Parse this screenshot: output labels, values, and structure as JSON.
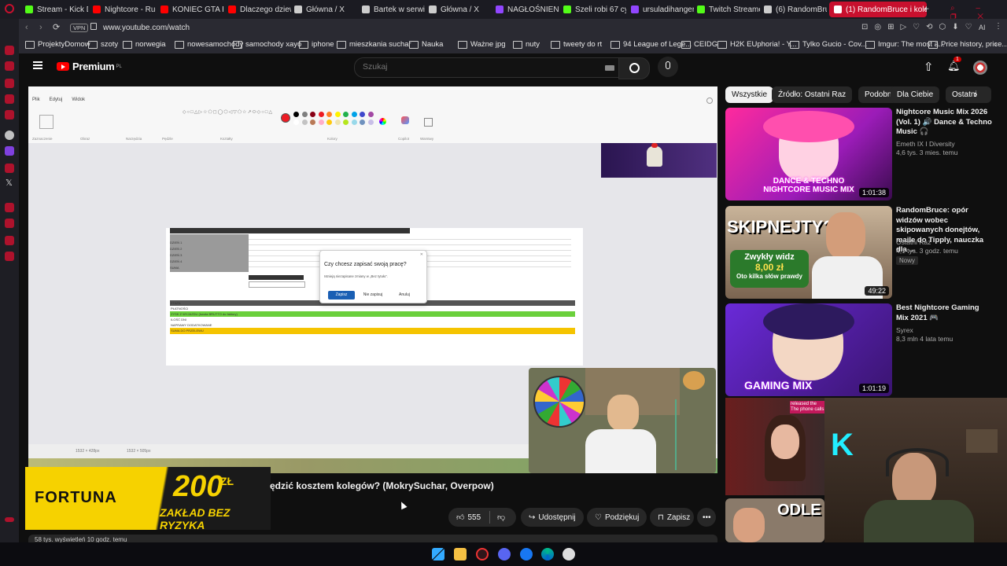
{
  "browser": {
    "tabs": [
      {
        "label": "Stream - Kick Da",
        "color": "#53fc18"
      },
      {
        "label": "Nightcore - Rude",
        "color": "#ff0000"
      },
      {
        "label": "KONIEC GTA RP",
        "color": "#ff0000"
      },
      {
        "label": "Dlaczego dziewc",
        "color": "#ff0000"
      },
      {
        "label": "Główna / X",
        "color": "#cccccc"
      },
      {
        "label": "Bartek w serwis",
        "color": "#cccccc"
      },
      {
        "label": "Główna / X",
        "color": "#cccccc"
      },
      {
        "label": "NAGŁOŚNIENIE",
        "color": "#9146ff"
      },
      {
        "label": "Szeli robi 67 cyc",
        "color": "#53fc18"
      },
      {
        "label": "ursuladihanger",
        "color": "#9146ff"
      },
      {
        "label": "Twitch Streamers",
        "color": "#53fc18"
      },
      {
        "label": "(6) RandomBruc",
        "color": "#cccccc"
      },
      {
        "label": "(1) RandomBruce i kole",
        "color": "#ffffff"
      }
    ],
    "url_badge": "VPN",
    "url": "www.youtube.com/watch",
    "ai_label": "AI",
    "bookmarks": [
      "ProjektyDomow",
      "szoty",
      "norwegia",
      "nowesamochody",
      "samochody xayo",
      "iphone",
      "mieszkania suchar",
      "Nauka",
      "Ważne jpg",
      "nuty",
      "tweety do rt",
      "94 League of Lege...",
      "CEIDG",
      "H2K EUphoria! - Y...",
      "Tylko Gucio - Cov...",
      "Imgur: The most a...",
      "Price history, price..."
    ]
  },
  "youtube": {
    "logo": "Premium",
    "logo_sup": "PL",
    "search_placeholder": "Szukaj",
    "notif_count": "1",
    "video_title": "ędzić kosztem kolegów? (MokrySuchar, Overpow)",
    "likes": "555",
    "share": "Udostępnij",
    "thanks": "Podziękuj",
    "save": "Zapisz",
    "below_text": "58 tys. wyświetleń  10 godz. temu",
    "chips": [
      "Wszystkie",
      "Źródło: Ostatni Raz",
      "Podobne",
      "Dla Ciebie",
      "Ostatni"
    ],
    "recs": [
      {
        "title": "Nightcore Music Mix 2026 (Vol. 1) 🔊 Dance & Techno Music 🎧",
        "channel": "Emeth IX I Diversity",
        "meta": "4,6 tys.  3 mies. temu",
        "duration": "1:01:38",
        "thumb_text": "DANCE & TECHNO\nNIGHTCORE MUSIC MIX",
        "badge": ""
      },
      {
        "title": "RandomBruce: opór widzów wobec skipowanych donejtów, maile do Tipply, nauczka dla ...",
        "channel": "Ostatni Raz",
        "meta": "4,1 tys.  3 godz. temu",
        "duration": "49:22",
        "thumb_text": "SKIPNEJTY?",
        "badge": "Nowy"
      },
      {
        "title": "Best Nightcore Gaming Mix 2021 🎮",
        "channel": "Syrex",
        "meta": "8,3 mln  4 lata temu",
        "duration": "1:01:19",
        "thumb_text": "GAMING MIX",
        "badge": ""
      }
    ],
    "rec2_pill": "Zwykły widz",
    "rec2_amount": "8,00 zł",
    "rec2_sub": "Oto kilka słów prawdy"
  },
  "paint": {
    "menu": [
      "Plik",
      "Edytuj",
      "Widok"
    ],
    "groups": [
      "Zaznaczenie",
      "Obraz",
      "Narzędzia",
      "Pędzle",
      "Kształty",
      "Kolory",
      "Copilot",
      "Warstwy"
    ],
    "status_left": "1532 × 428px",
    "status_right": "1532 × 505px",
    "swatches": [
      "#000000",
      "#7f7f7f",
      "#880015",
      "#ed1c24",
      "#ff7f27",
      "#fff200",
      "#22b14c",
      "#00a2e8",
      "#3f48cc",
      "#a349a4",
      "#ffffff",
      "#c3c3c3",
      "#b97a57",
      "#ffaec9",
      "#ffc90e",
      "#efe4b0",
      "#b5e61d",
      "#99d9ea",
      "#7092be",
      "#c8bfe7"
    ],
    "dialog_title": "Czy chcesz zapisać swoją pracę?",
    "dialog_text": "Istnieją niezapisane zmiany w „Bez tytułu”.",
    "dialog_save": "Zapisz",
    "dialog_nosave": "Nie zapisuj",
    "dialog_cancel": "Anuluj",
    "sheet_rows": [
      "DZIEŃ 1",
      "DZIEŃ 2",
      "DZIEŃ 3",
      "DZIEŃ 4",
      "SUMA"
    ],
    "sheet_bottom": [
      "ETAPA",
      "PŁATNOŚCI",
      "ZYSK Z WYJAZDU (kwota BRUTTO do faktury)",
      "ILOŚĆ DNI",
      "NAPRAWY DODATKOWANE",
      "SUMA DO PRZELEWU"
    ]
  },
  "ad": {
    "brand": "FORTUNA",
    "amount": "200",
    "currency": "ZŁ",
    "tagline": "ZAKŁAD BEZ RYZYKA"
  },
  "overlay": {
    "womancam_text": "released the\nThe phone calls",
    "thumb5_text": "ODLE"
  }
}
